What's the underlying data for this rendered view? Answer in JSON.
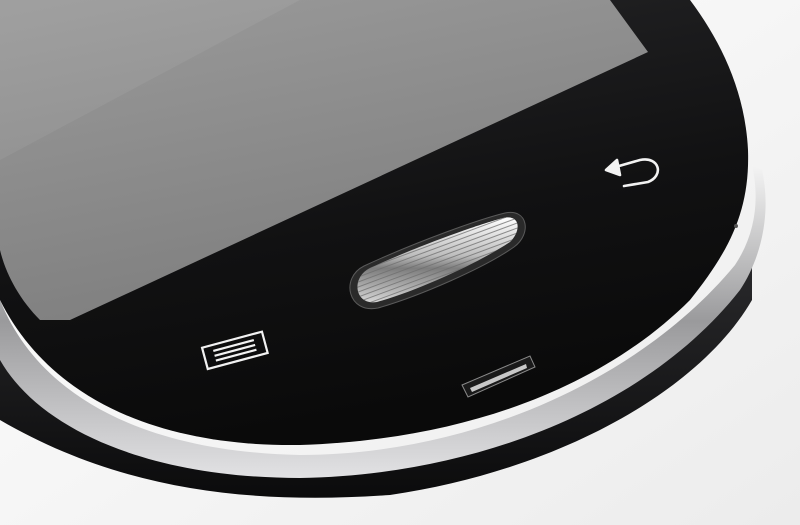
{
  "scene": {
    "subject": "smartphone-bottom-closeup",
    "colors": {
      "background": "#f4f4f4",
      "body": "#0c0c0d",
      "screen": "#8f8f8f",
      "bezel": "#161617",
      "chrome": "#d8d8d8",
      "icon": "#f2f2f2"
    },
    "icons": [
      "menu-icon",
      "back-icon"
    ],
    "controls": [
      "home-button",
      "menu-key",
      "back-key",
      "usb-port"
    ]
  }
}
